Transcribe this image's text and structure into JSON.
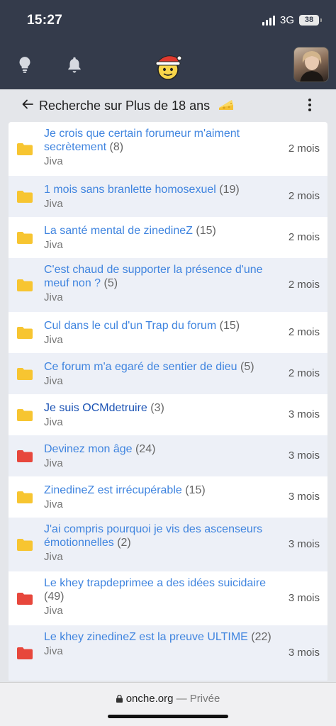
{
  "status_bar": {
    "time": "15:27",
    "network": "3G",
    "battery": "38"
  },
  "header": {
    "icons": [
      "lightbulb-icon",
      "bell-icon",
      "santa-mascot-icon",
      "user-avatar"
    ]
  },
  "page": {
    "title": "Recherche sur Plus de 18 ans",
    "title_emoji": "cheese-icon"
  },
  "topics": [
    {
      "title": "Je crois que certain forumeur m'aiment secrètement",
      "count": "(8)",
      "author": "Jiva",
      "date": "2 mois",
      "folder": "yellow",
      "visited": false
    },
    {
      "title": "1 mois sans branlette homosexuel",
      "count": "(19)",
      "author": "Jiva",
      "date": "2 mois",
      "folder": "yellow",
      "visited": false
    },
    {
      "title": "La santé mental de zinedineZ",
      "count": "(15)",
      "author": "Jiva",
      "date": "2 mois",
      "folder": "yellow",
      "visited": false
    },
    {
      "title": "C'est chaud de supporter la présence d'une meuf non ?",
      "count": "(5)",
      "author": "Jiva",
      "date": "2 mois",
      "folder": "yellow",
      "visited": false
    },
    {
      "title": "Cul dans le cul d'un Trap du forum",
      "count": "(15)",
      "author": "Jiva",
      "date": "2 mois",
      "folder": "yellow",
      "visited": false
    },
    {
      "title": "Ce forum m'a egaré de sentier de dieu",
      "count": "(5)",
      "author": "Jiva",
      "date": "2 mois",
      "folder": "yellow",
      "visited": false
    },
    {
      "title": "Je suis OCMdetruire",
      "count": "(3)",
      "author": "Jiva",
      "date": "3 mois",
      "folder": "yellow",
      "visited": true
    },
    {
      "title": "Devinez mon âge",
      "count": "(24)",
      "author": "Jiva",
      "date": "3 mois",
      "folder": "red",
      "visited": false
    },
    {
      "title": "ZinedineZ est irrécupérable",
      "count": "(15)",
      "author": "Jiva",
      "date": "3 mois",
      "folder": "yellow",
      "visited": false
    },
    {
      "title": "J'ai compris pourquoi je vis des ascenseurs émotionnelles",
      "count": "(2)",
      "author": "Jiva",
      "date": "3 mois",
      "folder": "yellow",
      "visited": false
    },
    {
      "title": "Le khey trapdeprimee a des idées suicidaire",
      "count": "(49)",
      "author": "Jiva",
      "date": "3 mois",
      "folder": "red",
      "visited": false
    },
    {
      "title": "Le khey zinedineZ est la preuve ULTIME",
      "count": "(22)",
      "author": "Jiva",
      "date": "3 mois",
      "folder": "red",
      "visited": false
    }
  ],
  "browser": {
    "domain": "onche.org",
    "separator": "—",
    "mode": "Privée"
  },
  "colors": {
    "header_bg": "#343b4b",
    "link": "#3f84df",
    "link_visited": "#1a52b4",
    "folder_yellow": "#f7c531",
    "folder_red": "#e7473c"
  }
}
